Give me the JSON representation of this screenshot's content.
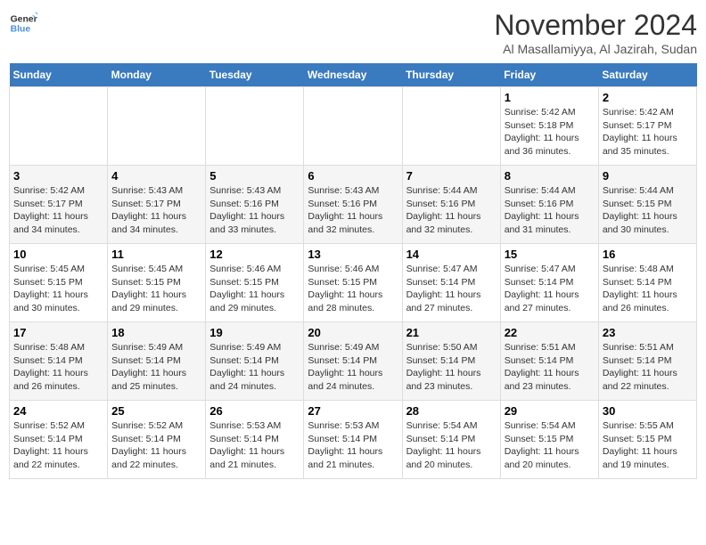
{
  "header": {
    "logo_line1": "General",
    "logo_line2": "Blue",
    "month": "November 2024",
    "location": "Al Masallamiyya, Al Jazirah, Sudan"
  },
  "days_of_week": [
    "Sunday",
    "Monday",
    "Tuesday",
    "Wednesday",
    "Thursday",
    "Friday",
    "Saturday"
  ],
  "weeks": [
    [
      {
        "day": "",
        "info": ""
      },
      {
        "day": "",
        "info": ""
      },
      {
        "day": "",
        "info": ""
      },
      {
        "day": "",
        "info": ""
      },
      {
        "day": "",
        "info": ""
      },
      {
        "day": "1",
        "info": "Sunrise: 5:42 AM\nSunset: 5:18 PM\nDaylight: 11 hours\nand 36 minutes."
      },
      {
        "day": "2",
        "info": "Sunrise: 5:42 AM\nSunset: 5:17 PM\nDaylight: 11 hours\nand 35 minutes."
      }
    ],
    [
      {
        "day": "3",
        "info": "Sunrise: 5:42 AM\nSunset: 5:17 PM\nDaylight: 11 hours\nand 34 minutes."
      },
      {
        "day": "4",
        "info": "Sunrise: 5:43 AM\nSunset: 5:17 PM\nDaylight: 11 hours\nand 34 minutes."
      },
      {
        "day": "5",
        "info": "Sunrise: 5:43 AM\nSunset: 5:16 PM\nDaylight: 11 hours\nand 33 minutes."
      },
      {
        "day": "6",
        "info": "Sunrise: 5:43 AM\nSunset: 5:16 PM\nDaylight: 11 hours\nand 32 minutes."
      },
      {
        "day": "7",
        "info": "Sunrise: 5:44 AM\nSunset: 5:16 PM\nDaylight: 11 hours\nand 32 minutes."
      },
      {
        "day": "8",
        "info": "Sunrise: 5:44 AM\nSunset: 5:16 PM\nDaylight: 11 hours\nand 31 minutes."
      },
      {
        "day": "9",
        "info": "Sunrise: 5:44 AM\nSunset: 5:15 PM\nDaylight: 11 hours\nand 30 minutes."
      }
    ],
    [
      {
        "day": "10",
        "info": "Sunrise: 5:45 AM\nSunset: 5:15 PM\nDaylight: 11 hours\nand 30 minutes."
      },
      {
        "day": "11",
        "info": "Sunrise: 5:45 AM\nSunset: 5:15 PM\nDaylight: 11 hours\nand 29 minutes."
      },
      {
        "day": "12",
        "info": "Sunrise: 5:46 AM\nSunset: 5:15 PM\nDaylight: 11 hours\nand 29 minutes."
      },
      {
        "day": "13",
        "info": "Sunrise: 5:46 AM\nSunset: 5:15 PM\nDaylight: 11 hours\nand 28 minutes."
      },
      {
        "day": "14",
        "info": "Sunrise: 5:47 AM\nSunset: 5:14 PM\nDaylight: 11 hours\nand 27 minutes."
      },
      {
        "day": "15",
        "info": "Sunrise: 5:47 AM\nSunset: 5:14 PM\nDaylight: 11 hours\nand 27 minutes."
      },
      {
        "day": "16",
        "info": "Sunrise: 5:48 AM\nSunset: 5:14 PM\nDaylight: 11 hours\nand 26 minutes."
      }
    ],
    [
      {
        "day": "17",
        "info": "Sunrise: 5:48 AM\nSunset: 5:14 PM\nDaylight: 11 hours\nand 26 minutes."
      },
      {
        "day": "18",
        "info": "Sunrise: 5:49 AM\nSunset: 5:14 PM\nDaylight: 11 hours\nand 25 minutes."
      },
      {
        "day": "19",
        "info": "Sunrise: 5:49 AM\nSunset: 5:14 PM\nDaylight: 11 hours\nand 24 minutes."
      },
      {
        "day": "20",
        "info": "Sunrise: 5:49 AM\nSunset: 5:14 PM\nDaylight: 11 hours\nand 24 minutes."
      },
      {
        "day": "21",
        "info": "Sunrise: 5:50 AM\nSunset: 5:14 PM\nDaylight: 11 hours\nand 23 minutes."
      },
      {
        "day": "22",
        "info": "Sunrise: 5:51 AM\nSunset: 5:14 PM\nDaylight: 11 hours\nand 23 minutes."
      },
      {
        "day": "23",
        "info": "Sunrise: 5:51 AM\nSunset: 5:14 PM\nDaylight: 11 hours\nand 22 minutes."
      }
    ],
    [
      {
        "day": "24",
        "info": "Sunrise: 5:52 AM\nSunset: 5:14 PM\nDaylight: 11 hours\nand 22 minutes."
      },
      {
        "day": "25",
        "info": "Sunrise: 5:52 AM\nSunset: 5:14 PM\nDaylight: 11 hours\nand 22 minutes."
      },
      {
        "day": "26",
        "info": "Sunrise: 5:53 AM\nSunset: 5:14 PM\nDaylight: 11 hours\nand 21 minutes."
      },
      {
        "day": "27",
        "info": "Sunrise: 5:53 AM\nSunset: 5:14 PM\nDaylight: 11 hours\nand 21 minutes."
      },
      {
        "day": "28",
        "info": "Sunrise: 5:54 AM\nSunset: 5:14 PM\nDaylight: 11 hours\nand 20 minutes."
      },
      {
        "day": "29",
        "info": "Sunrise: 5:54 AM\nSunset: 5:15 PM\nDaylight: 11 hours\nand 20 minutes."
      },
      {
        "day": "30",
        "info": "Sunrise: 5:55 AM\nSunset: 5:15 PM\nDaylight: 11 hours\nand 19 minutes."
      }
    ]
  ]
}
